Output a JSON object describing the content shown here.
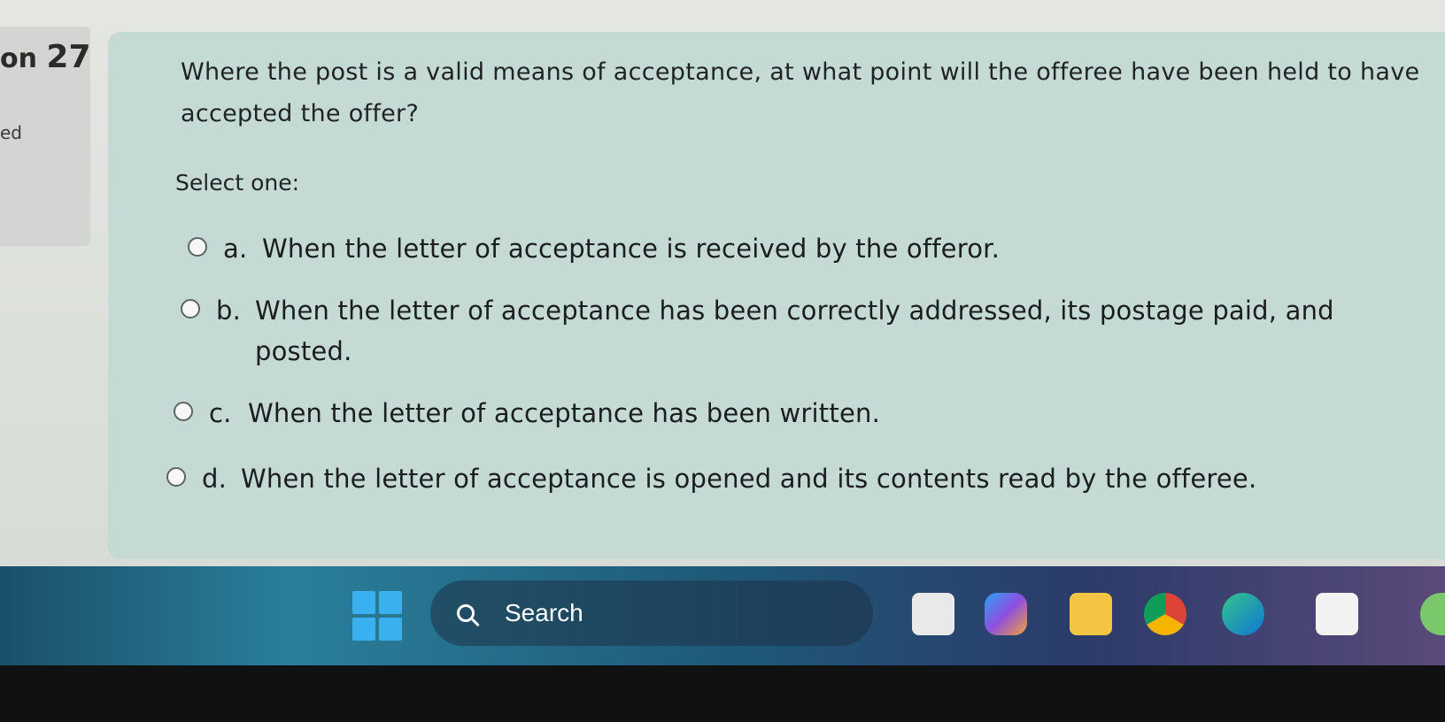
{
  "quiz": {
    "question_number_prefix": "on",
    "question_number": "27",
    "status_fragment": "ed",
    "question_text": "Where the post is a valid means of acceptance, at what point will the offeree have been held to have accepted the offer?",
    "prompt": "Select one:",
    "options": [
      {
        "letter": "a.",
        "text": "When the letter of acceptance is received by the offeror.",
        "selected": false
      },
      {
        "letter": "b.",
        "text": "When the letter of acceptance has been correctly addressed, its postage paid, and posted.",
        "selected": false
      },
      {
        "letter": "c.",
        "text": "When the letter of acceptance has been written.",
        "selected": false
      },
      {
        "letter": "d.",
        "text": "When the letter of acceptance is opened and its contents read by the offeree.",
        "selected": false
      }
    ]
  },
  "taskbar": {
    "search_label": "Search",
    "icons": [
      "windows-start-icon",
      "search-icon",
      "task-view-icon",
      "copilot-icon",
      "file-explorer-icon",
      "chrome-icon",
      "edge-icon",
      "store-icon",
      "weather-icon"
    ]
  },
  "colors": {
    "question_panel": "#c6dad5",
    "page_background": "#e4e6e2",
    "text": "#1f2422"
  }
}
